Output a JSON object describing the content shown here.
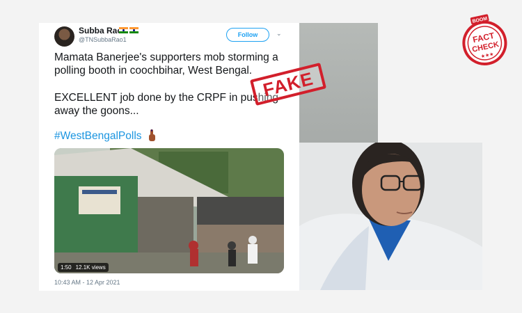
{
  "tweet": {
    "name": "Subba Rao",
    "handle": "@TNSubbaRao1",
    "follow_label": "Follow",
    "chevron": "⌄",
    "text_line1": "Mamata Banerjee's supporters mob storming a polling booth in coochbihar, West Bengal.",
    "text_line2": "EXCELLENT job done by the CRPF in pushing away the goons...",
    "hashtag": "#WestBengalPolls",
    "video_duration": "1:50",
    "video_views": "12.1K views",
    "timestamp": "10:43 AM - 12 Apr 2021"
  },
  "stamp": {
    "label": "FAKE",
    "color": "#d21f2b"
  },
  "logo": {
    "top_text": "BOOM",
    "line1": "FACT",
    "line2": "CHECK",
    "stars": "★★★",
    "color": "#d21f2b"
  },
  "icons": {
    "avatar": "avatar-icon",
    "flags": "india-flag-icon",
    "finger": "inked-finger-icon"
  }
}
